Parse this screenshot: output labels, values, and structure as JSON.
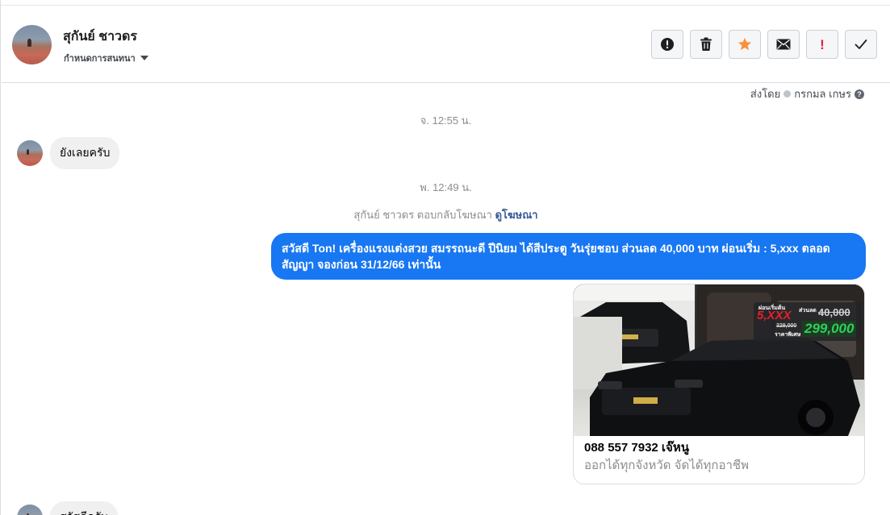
{
  "contact": {
    "name": "สุกันย์ ชาวดร",
    "set_conversation_label": "กำหนดการสนทนา"
  },
  "toolbar": {
    "buttons": [
      {
        "icon": "alert-circle-icon",
        "label": "Mark as spam"
      },
      {
        "icon": "trash-icon",
        "label": "Delete"
      },
      {
        "icon": "star-icon",
        "label": "Star",
        "color": "#f7923b"
      },
      {
        "icon": "envelope-icon",
        "label": "Mark unread"
      },
      {
        "icon": "exclamation-icon",
        "label": "Follow up",
        "color": "#e41e3f"
      },
      {
        "icon": "check-icon",
        "label": "Done"
      }
    ]
  },
  "conversation": {
    "sent_by_label": "ส่งโดย",
    "sent_by_name": "กรกมล เกษร",
    "messages": [
      {
        "type": "timestamp",
        "text": "จ. 12:55 น."
      },
      {
        "type": "incoming",
        "text": "ยังเลยครับ"
      },
      {
        "type": "timestamp",
        "text": "พ. 12:49 น."
      },
      {
        "type": "incoming_partial",
        "text": "สวัสดีครับ"
      }
    ],
    "reply_note": {
      "text": "สุกันย์ ชาวดร ตอบกลับโฆษณา",
      "link": "ดูโฆษณา"
    },
    "outgoing_text": "สวัสดี Ton! เครื่องแรงแต่งสวย สมรรถนะดี ปีนิยม ได้สีประตู วันรุ่ยชอบ ส่วนลด 40,000 บาท ผ่อนเริ่ม : 5,xxx ตลอดสัญญา จองก่อน 31/12/66 เท่านั้น",
    "ad_card": {
      "title": "088 557 7932 เจ๊หนู",
      "description": "ออกได้ทุกจังหวัด จัดได้ทุกอาชีพ",
      "badge": {
        "label_down": "ผ่อนเริ่มต้น",
        "down_value": "5,XXX",
        "label_discount": "ส่วนลด",
        "discount_value": "40,000",
        "label_price_old": "329,000",
        "label_special": "ราคาพิเศษ",
        "special_value": "299,000"
      }
    }
  },
  "colors": {
    "accent": "#1877f2",
    "star": "#f7923b",
    "alert": "#e41e3f"
  }
}
